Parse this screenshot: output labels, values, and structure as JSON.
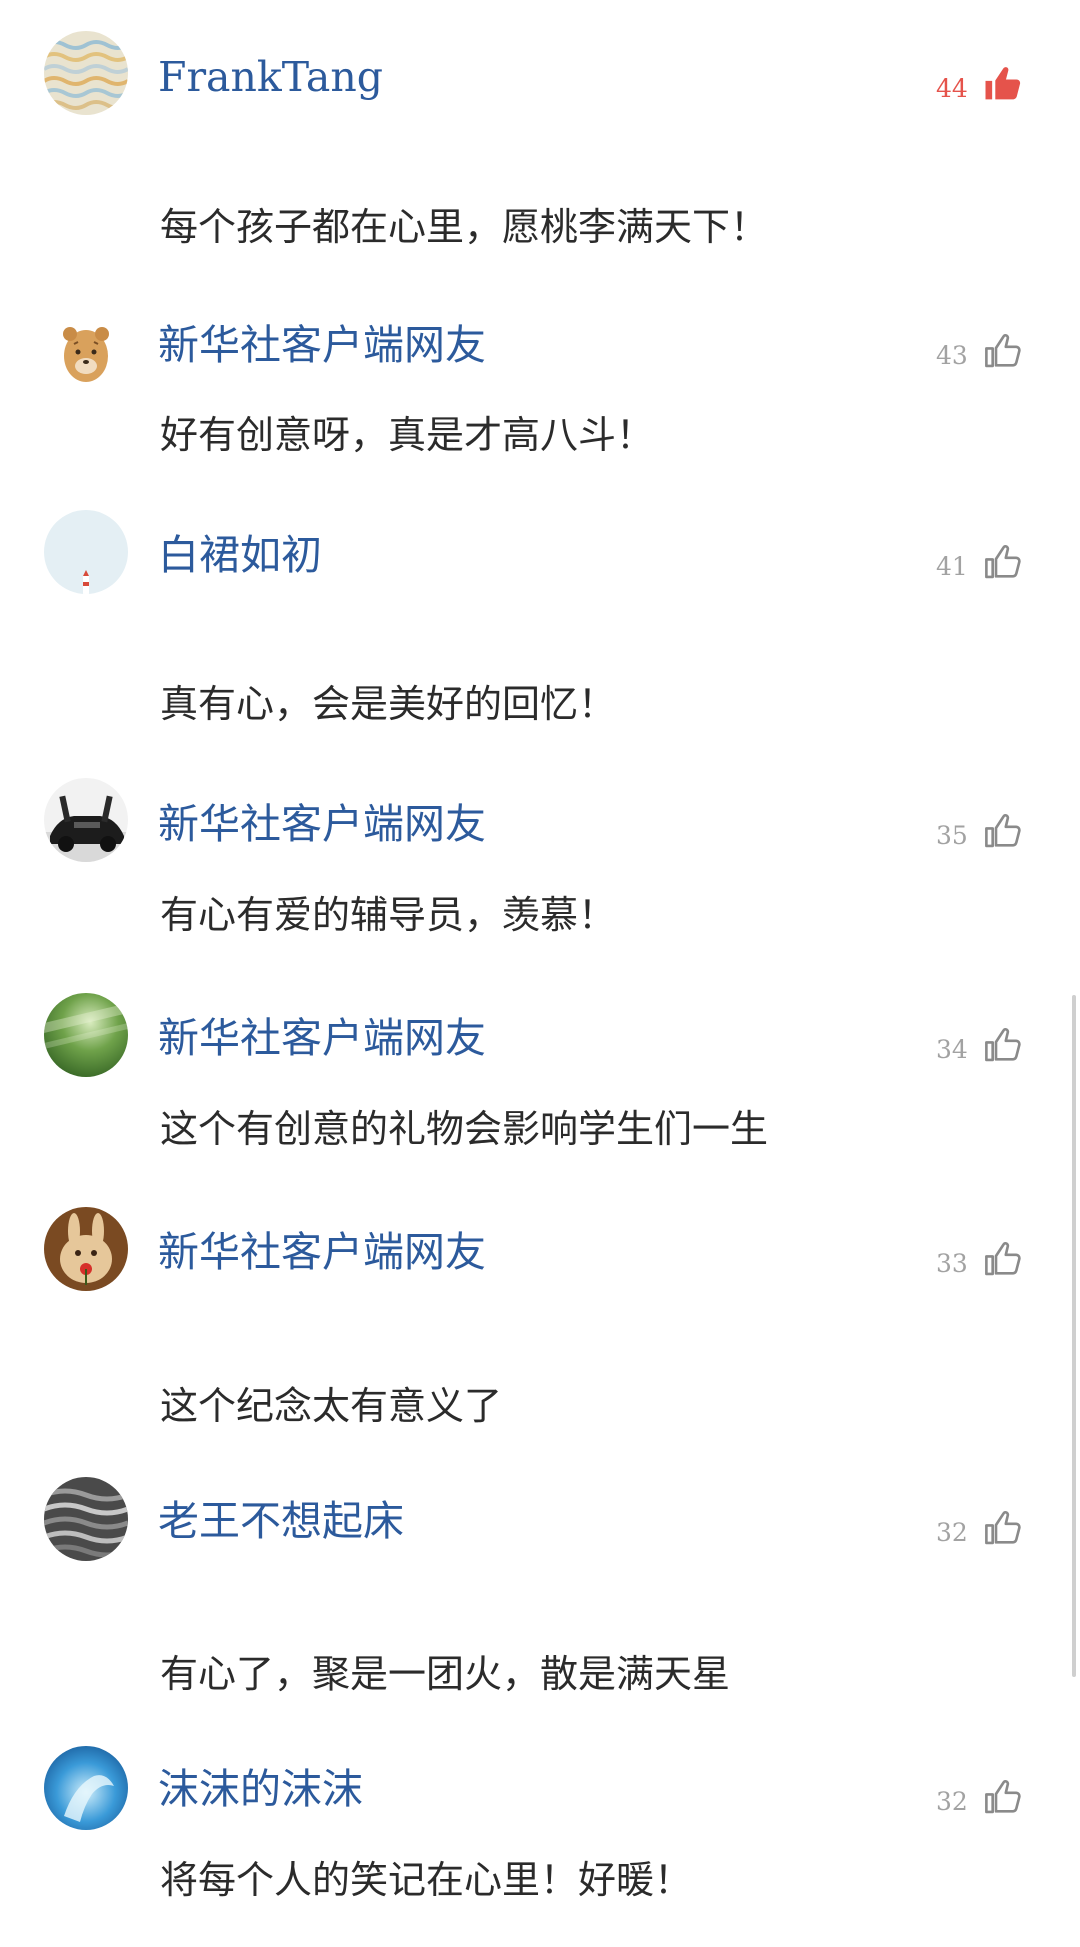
{
  "comments": [
    {
      "user": "FrankTang",
      "likes": "44",
      "liked": true,
      "text": "每个孩子都在心里，愿桃李满天下！",
      "avatar": "wavy-pattern"
    },
    {
      "user": "新华社客户端网友",
      "likes": "43",
      "liked": false,
      "text": "好有创意呀，真是才高八斗！",
      "avatar": "cartoon-bear"
    },
    {
      "user": "白裙如初",
      "likes": "41",
      "liked": false,
      "text": "真有心，会是美好的回忆！",
      "avatar": "sky-lighthouse"
    },
    {
      "user": "新华社客户端网友",
      "likes": "35",
      "liked": false,
      "text": "有心有爱的辅导员，羡慕！",
      "avatar": "sports-car"
    },
    {
      "user": "新华社客户端网友",
      "likes": "34",
      "liked": false,
      "text": "这个有创意的礼物会影响学生们一生",
      "avatar": "green-forest"
    },
    {
      "user": "新华社客户端网友",
      "likes": "33",
      "liked": false,
      "text": "这个纪念太有意义了",
      "avatar": "bunny"
    },
    {
      "user": "老王不想起床",
      "likes": "32",
      "liked": false,
      "text": "有心了，聚是一团火，散是满天星",
      "avatar": "grey-waves"
    },
    {
      "user": "沫沫的沫沫",
      "likes": "32",
      "liked": false,
      "text": "将每个人的笑记在心里！好暖！",
      "avatar": "blue-splash"
    }
  ],
  "colors": {
    "username": "#2c5a9c",
    "like_count": "#a2a2a2",
    "liked": "#e5534b",
    "text": "#2b2b2b"
  }
}
